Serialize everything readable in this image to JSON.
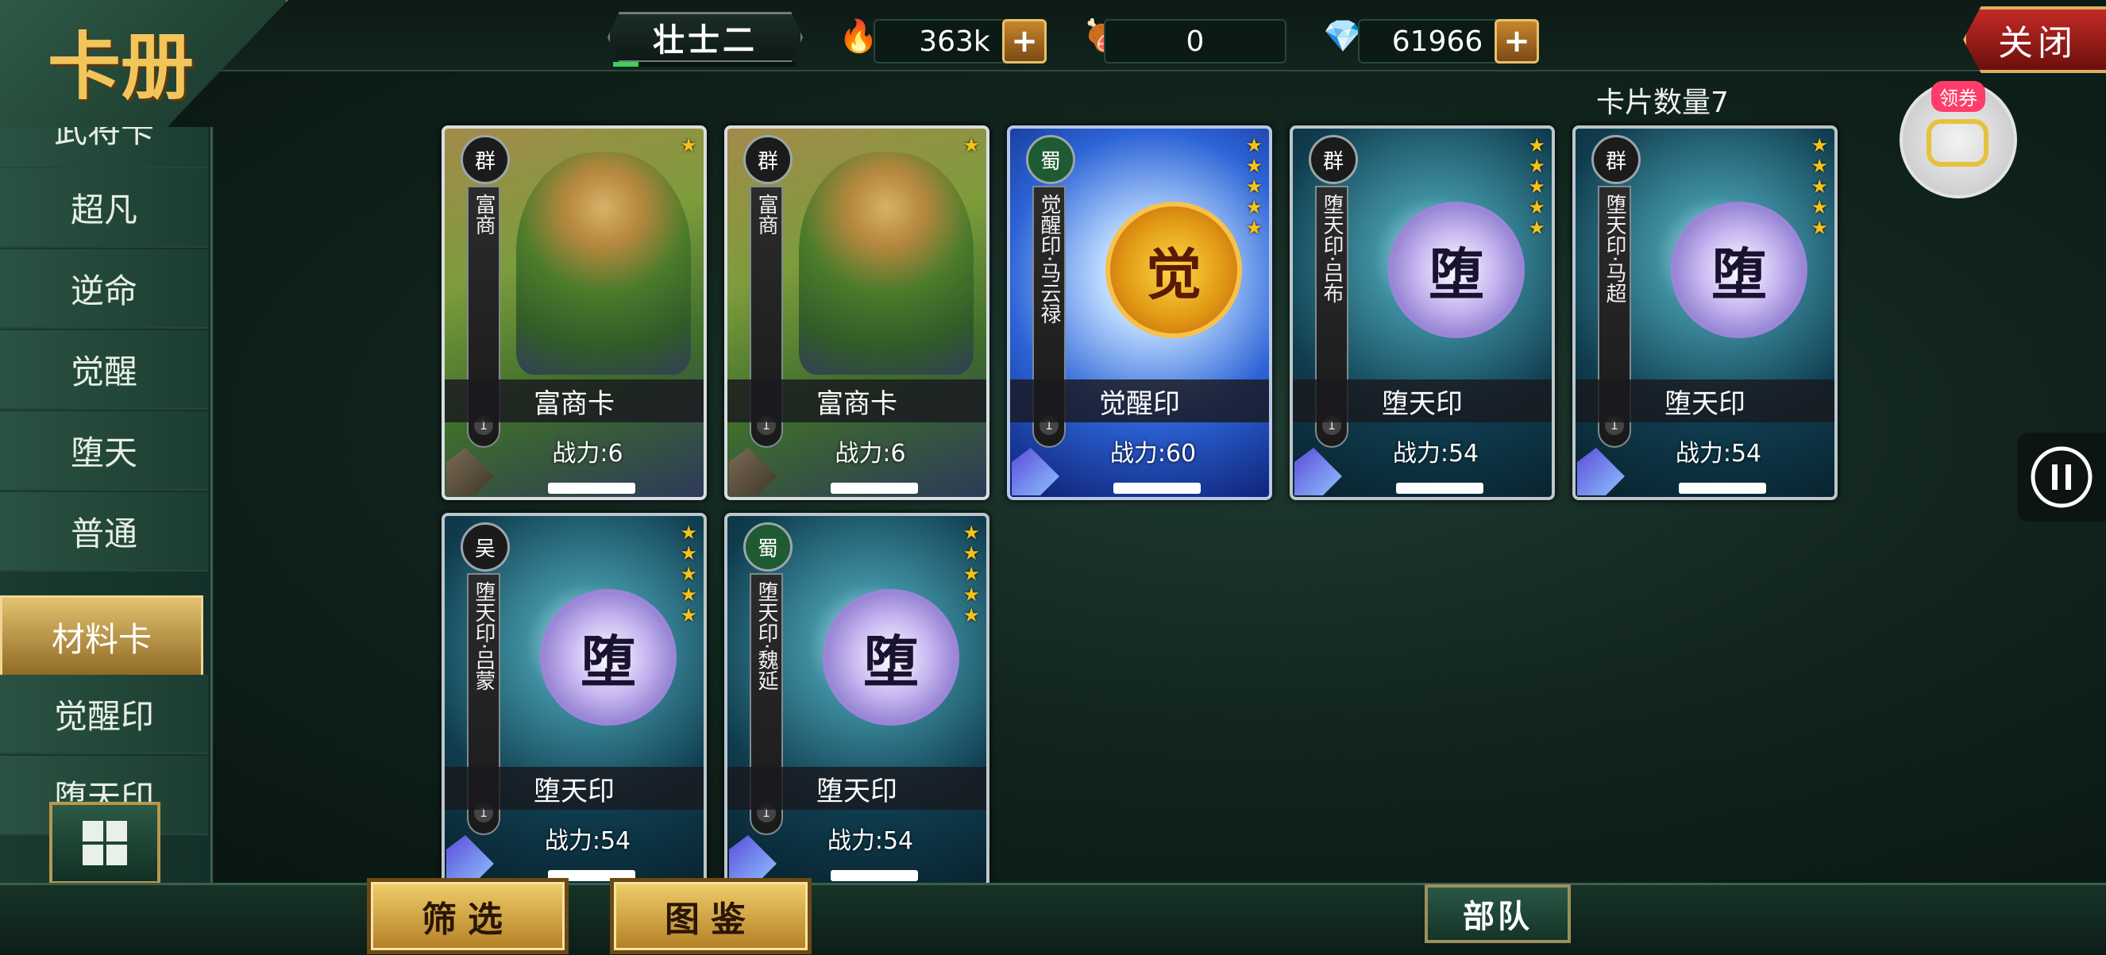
{
  "header": {
    "rank": "壮士二",
    "rank_progress": 0.14,
    "resources": [
      {
        "icon": "flame-icon",
        "value": "363k"
      },
      {
        "icon": "meat-icon",
        "value": "0"
      },
      {
        "icon": "diamond-icon",
        "value": "61966"
      }
    ],
    "close_label": "关闭"
  },
  "logo": "卡册",
  "sidebar": {
    "items": [
      "武将卡",
      "超凡",
      "逆命",
      "觉醒",
      "堕天",
      "普通",
      "材料卡",
      "觉醒印",
      "堕天印"
    ],
    "active": "材料卡"
  },
  "content": {
    "card_count": "卡片数量7",
    "cards": [
      {
        "type": "merchant",
        "faction": "群",
        "vertical_name": "富商",
        "level": "1",
        "stars": 1,
        "name": "富商卡",
        "power": "战力:6"
      },
      {
        "type": "merchant",
        "faction": "群",
        "vertical_name": "富商",
        "level": "1",
        "stars": 1,
        "name": "富商卡",
        "power": "战力:6"
      },
      {
        "type": "awaken",
        "faction": "蜀",
        "vertical_name": "觉醒印·马云禄",
        "level": "1",
        "stars": 5,
        "name": "觉醒印",
        "power": "战力:60",
        "seal": "觉"
      },
      {
        "type": "fallen",
        "faction": "群",
        "vertical_name": "堕天印·吕布",
        "level": "1",
        "stars": 5,
        "name": "堕天印",
        "power": "战力:54",
        "seal": "堕"
      },
      {
        "type": "fallen",
        "faction": "群",
        "vertical_name": "堕天印·马超",
        "level": "1",
        "stars": 5,
        "name": "堕天印",
        "power": "战力:54",
        "seal": "堕"
      },
      {
        "type": "fallen",
        "faction": "吴",
        "vertical_name": "堕天印·吕蒙",
        "level": "1",
        "stars": 5,
        "name": "堕天印",
        "power": "战力:54",
        "seal": "堕"
      },
      {
        "type": "fallen",
        "faction": "蜀",
        "vertical_name": "堕天印·魏延",
        "level": "1",
        "stars": 5,
        "name": "堕天印",
        "power": "战力:54",
        "seal": "堕"
      }
    ]
  },
  "floating": {
    "coupon_label": "领券"
  },
  "footer": {
    "filter_label": "筛选",
    "gallery_label": "图鉴",
    "team_label": "部队"
  },
  "colors": {
    "accent_gold": "#e2c26f",
    "star": "#f6c21a",
    "close_red": "#c22a24"
  }
}
